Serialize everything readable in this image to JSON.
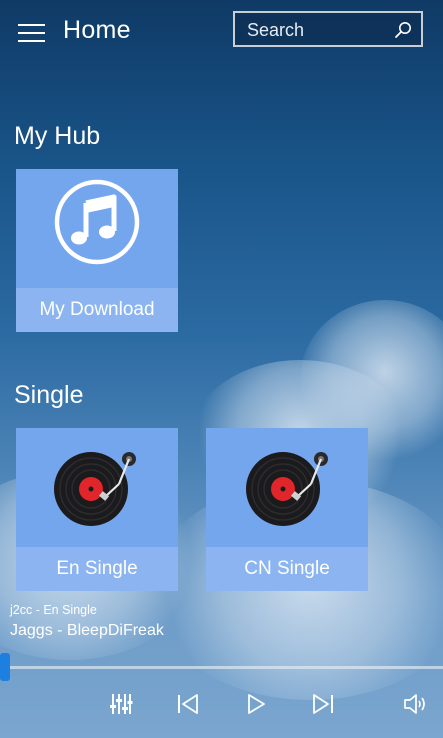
{
  "header": {
    "title": "Home",
    "search_placeholder": "Search"
  },
  "hub": {
    "title": "My Hub",
    "tiles": [
      {
        "label": "My Download",
        "icon": "music-note-icon"
      }
    ]
  },
  "single": {
    "title": "Single",
    "tiles": [
      {
        "label": "En Single",
        "icon": "vinyl-record-icon"
      },
      {
        "label": "CN Single",
        "icon": "vinyl-record-icon"
      }
    ]
  },
  "player": {
    "source": "j2cc - En Single",
    "track": "Jaggs - BleepDiFreak",
    "progress": 0.01,
    "controls": [
      "equalizer-icon",
      "previous-icon",
      "play-icon",
      "next-icon",
      "volume-icon"
    ]
  },
  "colors": {
    "tile": "#74a6ee",
    "accent": "#1d7fe0",
    "vinyl_label": "#e0262b"
  }
}
